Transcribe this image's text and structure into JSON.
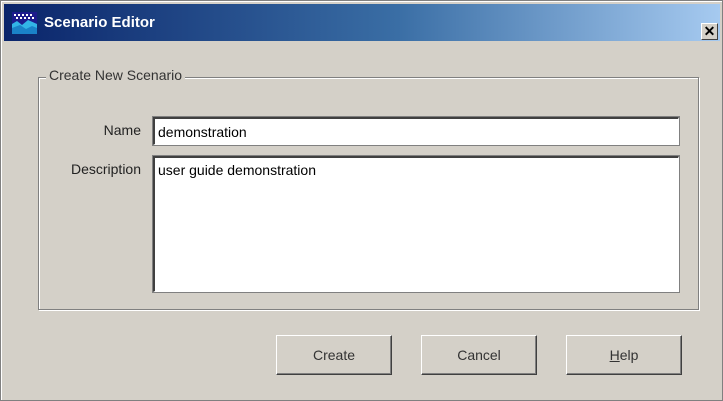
{
  "window": {
    "title": "Scenario Editor",
    "close_label": "✕"
  },
  "group": {
    "legend": "Create New Scenario"
  },
  "form": {
    "name_label": "Name",
    "name_value": "demonstration",
    "description_label": "Description",
    "description_value": "user guide demonstration"
  },
  "buttons": {
    "create": "Create",
    "cancel": "Cancel",
    "help_mnemonic": "H",
    "help_rest": "elp"
  },
  "colors": {
    "titlebar_start": "#0a246a",
    "titlebar_end": "#a6caf0",
    "dialog_bg": "#d4d0c8"
  }
}
